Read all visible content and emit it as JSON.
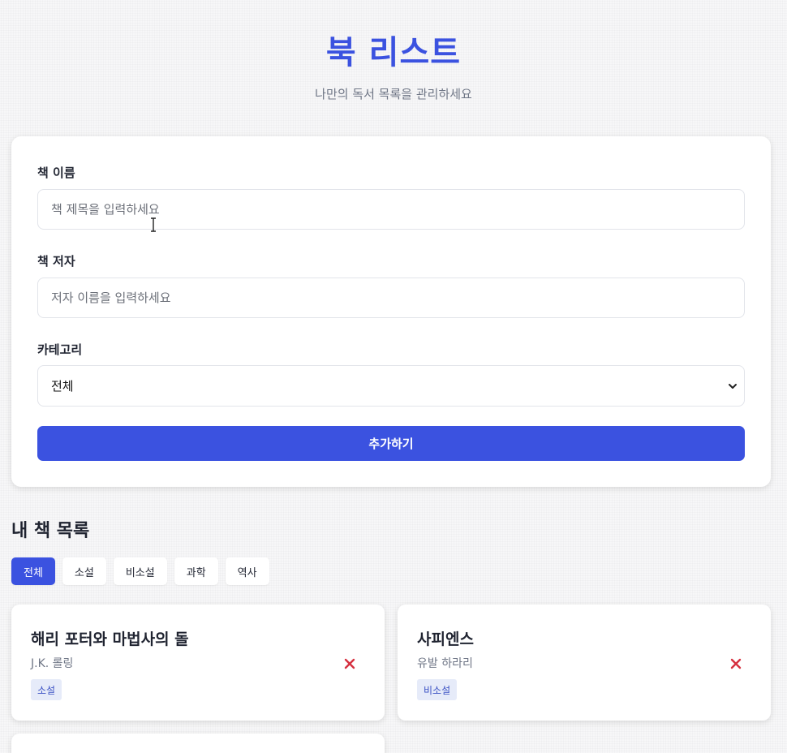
{
  "header": {
    "title": "북 리스트",
    "subtitle": "나만의 독서 목록을 관리하세요"
  },
  "form": {
    "title_label": "책 이름",
    "title_placeholder": "책 제목을 입력하세요",
    "title_value": "",
    "author_label": "책 저자",
    "author_placeholder": "저자 이름을 입력하세요",
    "author_value": "",
    "category_label": "카테고리",
    "category_selected": "전체",
    "submit_label": "추가하기"
  },
  "list": {
    "heading": "내 책 목록",
    "filters": [
      {
        "label": "전체",
        "active": true
      },
      {
        "label": "소설",
        "active": false
      },
      {
        "label": "비소설",
        "active": false
      },
      {
        "label": "과학",
        "active": false
      },
      {
        "label": "역사",
        "active": false
      }
    ],
    "books": [
      {
        "title": "해리 포터와 마법사의 돌",
        "author": "J.K. 롤링",
        "category": "소설"
      },
      {
        "title": "사피엔스",
        "author": "유발 하라리",
        "category": "비소설"
      }
    ]
  },
  "icons": {
    "select_arrow": "chevron-down-icon",
    "delete": "close-icon",
    "cursor": "text-cursor-icon"
  },
  "colors": {
    "accent": "#3b52e0",
    "delete": "#d6303f",
    "tag_bg": "#e6ebf9",
    "tag_text": "#3b52c4"
  }
}
